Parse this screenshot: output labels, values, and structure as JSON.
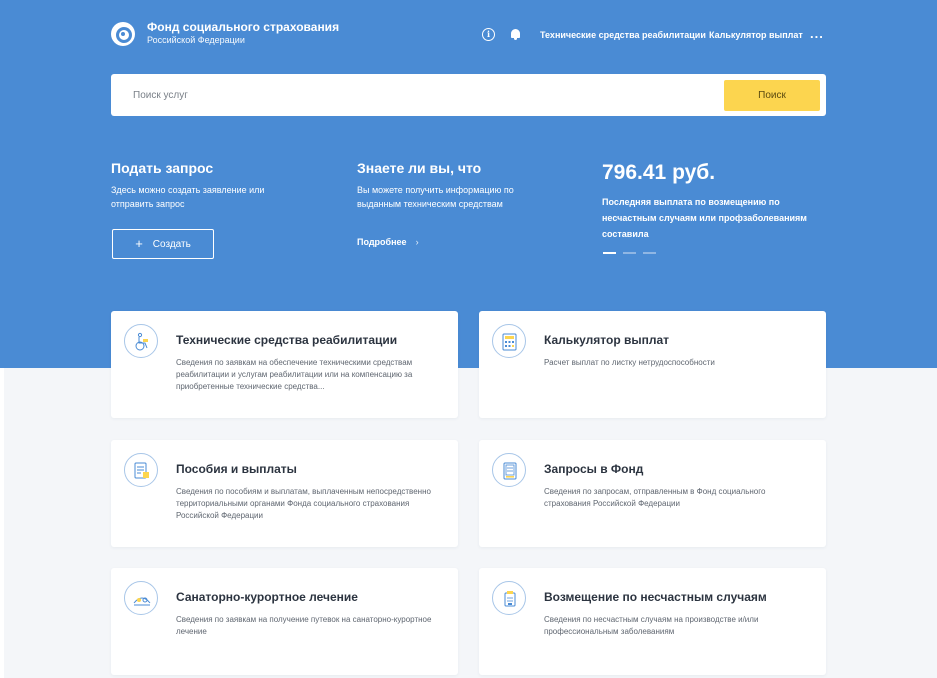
{
  "header": {
    "org_title": "Фонд социального страхования",
    "org_subtitle": "Российской Федерации",
    "info_icon": "i",
    "nav": [
      "Технические средства реабилитации",
      "Калькулятор выплат"
    ],
    "more": "..."
  },
  "search": {
    "placeholder": "Поиск услуг",
    "button": "Поиск"
  },
  "hero": {
    "request": {
      "title": "Подать запрос",
      "text": "Здесь можно создать заявление или отправить запрос",
      "button_icon": "+",
      "button": "Создать"
    },
    "tip": {
      "title": "Знаете ли вы, что",
      "text": "Вы можете получить информацию по выданным техническим средствам",
      "link": "Подробнее",
      "link_icon": "›"
    },
    "payment": {
      "amount": "796.41 руб.",
      "text": "Последняя выплата по возмещению по несчастным случаям или профзаболеваниям составила"
    },
    "slider": {
      "count": 3,
      "active": 1
    }
  },
  "colors": {
    "hero": "#4a8bd4",
    "accent": "#fcd54f",
    "icon_stroke": "#4a8bd4",
    "icon_fill": "#fcd54f"
  },
  "cards": [
    {
      "icon": "wheelchair-icon",
      "title": "Технические средства реабилитации",
      "description": "Сведения по заявкам на обеспечение техническими средствам реабилитации и услугам реабилитации или на компенсацию за приобретенные технические средства..."
    },
    {
      "icon": "calculator-icon",
      "title": "Калькулятор выплат",
      "description": "Расчет выплат по листку нетрудоспособности"
    },
    {
      "icon": "document-payment-icon",
      "title": "Пособия и выплаты",
      "description": "Сведения по пособиям и выплатам, выплаченным непосредственно территориальными органами Фонда социального страхования Российской Федерации"
    },
    {
      "icon": "request-document-icon",
      "title": "Запросы в Фонд",
      "description": "Сведения по запросам, отправленным в Фонд социального страхования Российской Федерации"
    },
    {
      "icon": "sanatorium-icon",
      "title": "Санаторно-курортное лечение",
      "description": "Сведения по заявкам на получение путевок на санаторно-курортное лечение"
    },
    {
      "icon": "compensation-icon",
      "title": "Возмещение по несчастным случаям",
      "description": "Сведения по несчастным случаям на производстве и/или профессиональным заболеваниям"
    }
  ]
}
